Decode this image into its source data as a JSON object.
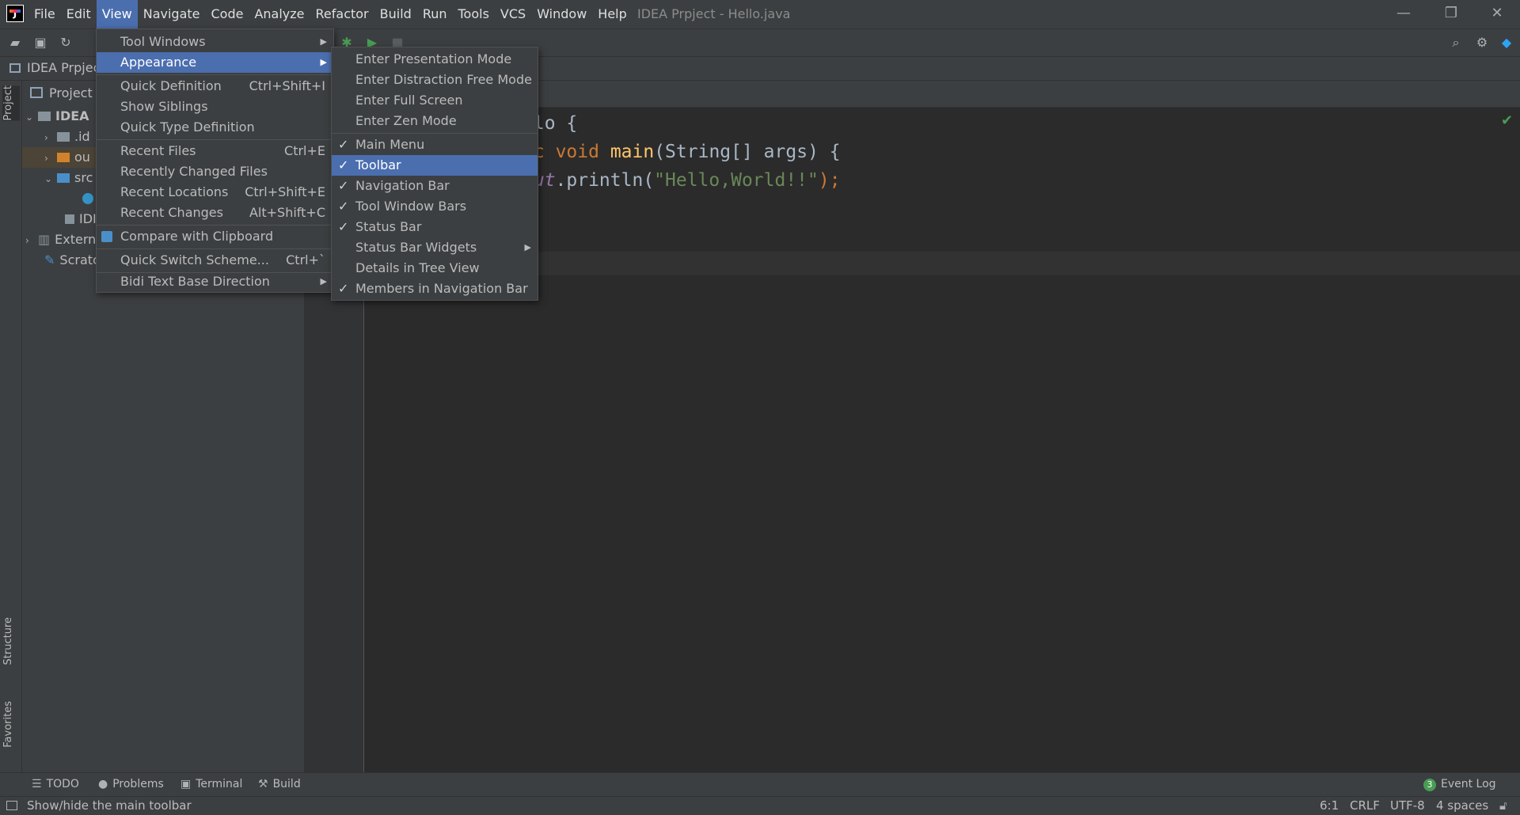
{
  "menubar": {
    "items": [
      "File",
      "Edit",
      "View",
      "Navigate",
      "Code",
      "Analyze",
      "Refactor",
      "Build",
      "Run",
      "Tools",
      "VCS",
      "Window",
      "Help"
    ],
    "window_title": "IDEA Prpject - Hello.java"
  },
  "navbar": {
    "project": "IDEA Prpject"
  },
  "sidebar": {
    "project_tab": "Project",
    "structure_tab": "Structure",
    "favorites_tab": "Favorites",
    "header": "Project",
    "tree": [
      "IDEA",
      ".id",
      "ou",
      "src",
      "",
      "IDI",
      "Extern",
      "Scratc"
    ]
  },
  "view_menu": {
    "items": [
      {
        "label": "Tool Windows",
        "shortcut": "",
        "submenu": true
      },
      {
        "label": "Appearance",
        "shortcut": "",
        "submenu": true
      },
      {
        "label": "Quick Definition",
        "shortcut": "Ctrl+Shift+I"
      },
      {
        "label": "Show Siblings",
        "shortcut": ""
      },
      {
        "label": "Quick Type Definition",
        "shortcut": ""
      },
      {
        "label": "Recent Files",
        "shortcut": "Ctrl+E"
      },
      {
        "label": "Recently Changed Files",
        "shortcut": ""
      },
      {
        "label": "Recent Locations",
        "shortcut": "Ctrl+Shift+E"
      },
      {
        "label": "Recent Changes",
        "shortcut": "Alt+Shift+C"
      },
      {
        "label": "Compare with Clipboard",
        "shortcut": ""
      },
      {
        "label": "Quick Switch Scheme...",
        "shortcut": "Ctrl+`"
      },
      {
        "label": "Bidi Text Base Direction",
        "shortcut": "",
        "submenu": true
      }
    ]
  },
  "appearance_menu": {
    "items": [
      {
        "label": "Enter Presentation Mode",
        "checked": false
      },
      {
        "label": "Enter Distraction Free Mode",
        "checked": false
      },
      {
        "label": "Enter Full Screen",
        "checked": false
      },
      {
        "label": "Enter Zen Mode",
        "checked": false
      },
      {
        "label": "Main Menu",
        "checked": true
      },
      {
        "label": "Toolbar",
        "checked": true
      },
      {
        "label": "Navigation Bar",
        "checked": true
      },
      {
        "label": "Tool Window Bars",
        "checked": true
      },
      {
        "label": "Status Bar",
        "checked": true
      },
      {
        "label": "Status Bar Widgets",
        "checked": false,
        "submenu": true
      },
      {
        "label": "Details in Tree View",
        "checked": false
      },
      {
        "label": "Members in Navigation Bar",
        "checked": true
      }
    ]
  },
  "editor": {
    "line1_a": "llo {",
    "line2_kw1": "ic",
    "line2_kw2": "void",
    "line2_fn": "main",
    "line2_rest": "(String[] args) {",
    "line3_fld": "out",
    "line3_mid": ".println(",
    "line3_str": "\"Hello,World!!\"",
    "line3_end": ");"
  },
  "bottom_tools": {
    "todo": "TODO",
    "problems": "Problems",
    "terminal": "Terminal",
    "build": "Build",
    "event_log": "Event Log",
    "event_count": "3"
  },
  "statusbar": {
    "message": "Show/hide the main toolbar",
    "position": "6:1",
    "line_sep": "CRLF",
    "encoding": "UTF-8",
    "indent": "4 spaces"
  },
  "colors": {
    "accent": "#4b6eaf",
    "background": "#2b2b2b",
    "panel": "#3c3f41"
  }
}
